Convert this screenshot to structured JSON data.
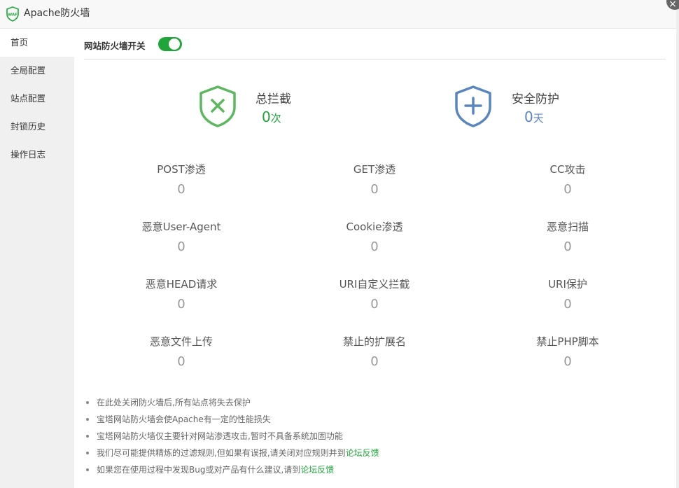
{
  "window": {
    "title": "Apache防火墙",
    "close_symbol": "×"
  },
  "sidebar": {
    "items": [
      {
        "label": "首页",
        "active": true
      },
      {
        "label": "全局配置"
      },
      {
        "label": "站点配置"
      },
      {
        "label": "封锁历史"
      },
      {
        "label": "操作日志"
      }
    ]
  },
  "main": {
    "switch_label": "网站防火墙开关",
    "switch_on": true,
    "summary": {
      "total": {
        "label": "总拦截",
        "value": "0",
        "unit": "次"
      },
      "safe": {
        "label": "安全防护",
        "value": "0",
        "unit": "天"
      }
    },
    "stats": [
      {
        "name": "POST渗透",
        "value": "0"
      },
      {
        "name": "GET渗透",
        "value": "0"
      },
      {
        "name": "CC攻击",
        "value": "0"
      },
      {
        "name": "恶意User-Agent",
        "value": "0"
      },
      {
        "name": "Cookie渗透",
        "value": "0"
      },
      {
        "name": "恶意扫描",
        "value": "0"
      },
      {
        "name": "恶意HEAD请求",
        "value": "0"
      },
      {
        "name": "URI自定义拦截",
        "value": "0"
      },
      {
        "name": "URI保护",
        "value": "0"
      },
      {
        "name": "恶意文件上传",
        "value": "0"
      },
      {
        "name": "禁止的扩展名",
        "value": "0"
      },
      {
        "name": "禁止PHP脚本",
        "value": "0"
      }
    ],
    "notes": [
      {
        "text": "在此处关闭防火墙后,所有站点将失去保护"
      },
      {
        "text": "宝塔网站防火墙会使Apache有一定的性能损失"
      },
      {
        "text": "宝塔网站防火墙仅主要针对网站渗透攻击,暂时不具备系统加固功能"
      },
      {
        "text": "我们尽可能提供精炼的过滤规则,但如果有误报,请关闭对应规则并到",
        "link": "论坛反馈"
      },
      {
        "text": "如果您在使用过程中发现Bug或对产品有什么建议,请到",
        "link": "论坛反馈"
      }
    ]
  },
  "colors": {
    "accent": "#20a53a",
    "shield_green": "#5cb85c",
    "shield_blue": "#5a86c0"
  }
}
